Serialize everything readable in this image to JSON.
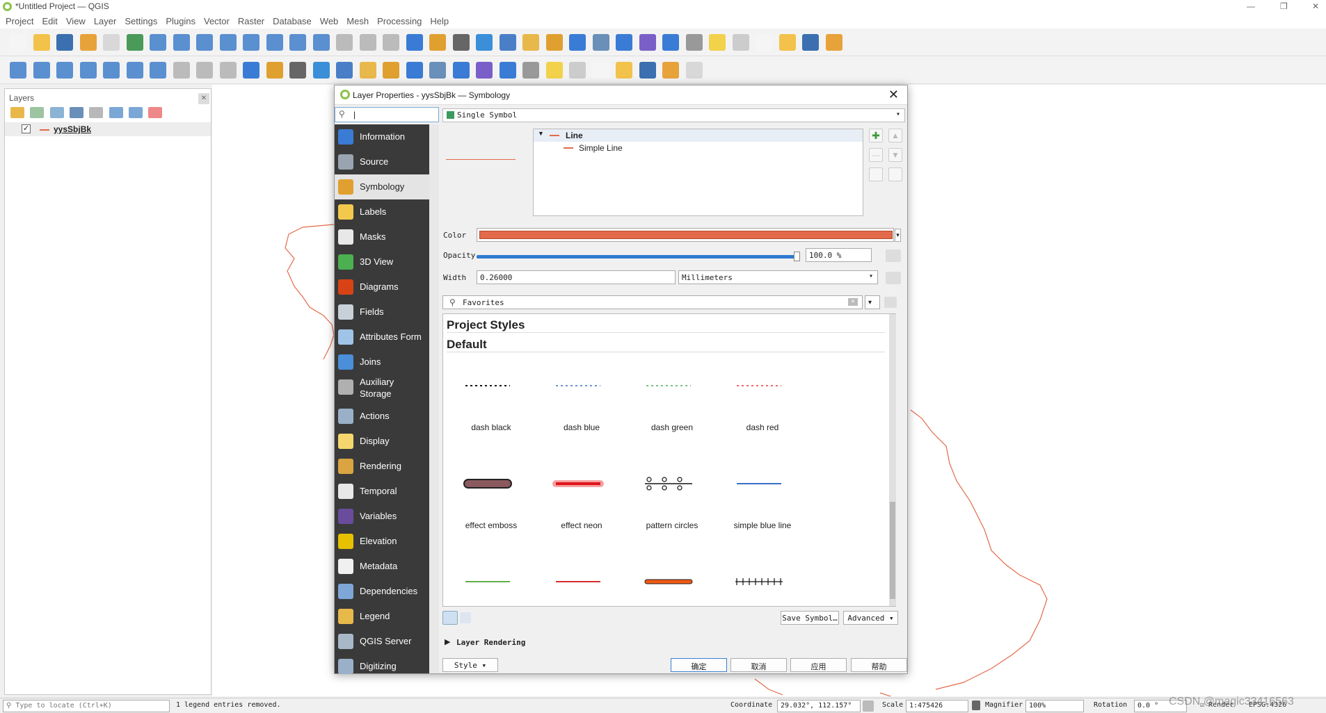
{
  "app": {
    "title": "*Untitled Project — QGIS"
  },
  "menu": [
    "Project",
    "Edit",
    "View",
    "Layer",
    "Settings",
    "Plugins",
    "Vector",
    "Raster",
    "Database",
    "Web",
    "Mesh",
    "Processing",
    "Help"
  ],
  "layers_panel": {
    "title": "Layers",
    "layer_name": "yysSbjBk",
    "checked": "✓"
  },
  "dialog": {
    "title": "Layer Properties - yysSbjBk — Symbology",
    "search_value": "|",
    "renderer": "Single Symbol",
    "nav": [
      {
        "label": "Information",
        "icon": "information-icon",
        "color": "#3a7bd5"
      },
      {
        "label": "Source",
        "icon": "source-icon",
        "color": "#9aa4b0"
      },
      {
        "label": "Symbology",
        "icon": "symbology-icon",
        "color": "#e0a030"
      },
      {
        "label": "Labels",
        "icon": "labels-icon",
        "color": "#f2c94c"
      },
      {
        "label": "Masks",
        "icon": "masks-icon",
        "color": "#e8e8e8"
      },
      {
        "label": "3D View",
        "icon": "3d-view-icon",
        "color": "#4caf50"
      },
      {
        "label": "Diagrams",
        "icon": "diagrams-icon",
        "color": "#d84315"
      },
      {
        "label": "Fields",
        "icon": "fields-icon",
        "color": "#c8d0d8"
      },
      {
        "label": "Attributes Form",
        "icon": "attributes-form-icon",
        "color": "#a0c4e8"
      },
      {
        "label": "Joins",
        "icon": "joins-icon",
        "color": "#4a8fd8"
      },
      {
        "label": "Auxiliary\nStorage",
        "icon": "auxiliary-storage-icon",
        "color": "#b0b0b0"
      },
      {
        "label": "Actions",
        "icon": "actions-icon",
        "color": "#9ab0c8"
      },
      {
        "label": "Display",
        "icon": "display-icon",
        "color": "#f5d76e"
      },
      {
        "label": "Rendering",
        "icon": "rendering-icon",
        "color": "#d9a441"
      },
      {
        "label": "Temporal",
        "icon": "temporal-icon",
        "color": "#e8e8e8"
      },
      {
        "label": "Variables",
        "icon": "variables-icon",
        "color": "#6a4c9c"
      },
      {
        "label": "Elevation",
        "icon": "elevation-icon",
        "color": "#e5c100"
      },
      {
        "label": "Metadata",
        "icon": "metadata-icon",
        "color": "#f0f0f0"
      },
      {
        "label": "Dependencies",
        "icon": "dependencies-icon",
        "color": "#7ea7d8"
      },
      {
        "label": "Legend",
        "icon": "legend-icon",
        "color": "#e7b94a"
      },
      {
        "label": "QGIS Server",
        "icon": "qgis-server-icon",
        "color": "#a8b8c8"
      },
      {
        "label": "Digitizing",
        "icon": "digitizing-icon",
        "color": "#9ab0c8"
      }
    ],
    "tree": {
      "root": "Line",
      "child": "Simple Line"
    },
    "color_label": "Color",
    "color_value": "#e36a4a",
    "opacity_label": "Opacity",
    "opacity_value": "100.0 %",
    "opacity_fraction": 1.0,
    "width_label": "Width",
    "width_value": "0.26000",
    "unit": "Millimeters",
    "favorites": "Favorites",
    "section1": "Project Styles",
    "section2": "Default",
    "symbols": [
      {
        "name": "dash  black",
        "kind": "dash",
        "color": "#111111"
      },
      {
        "name": "dash blue",
        "kind": "dash",
        "color": "#3a6fc4"
      },
      {
        "name": "dash green",
        "kind": "dash",
        "color": "#4caf50"
      },
      {
        "name": "dash red",
        "kind": "dash",
        "color": "#e53935"
      },
      {
        "name": "effect emboss",
        "kind": "emboss",
        "color": "#8a5a5e"
      },
      {
        "name": "effect neon",
        "kind": "neon",
        "color": "#e0151d"
      },
      {
        "name": "pattern circles",
        "kind": "circles",
        "color": "#111111"
      },
      {
        "name": "simple blue line",
        "kind": "line",
        "color": "#3a6fc4"
      },
      {
        "name": "",
        "kind": "line",
        "color": "#5fae4a"
      },
      {
        "name": "",
        "kind": "line",
        "color": "#d32f2f"
      },
      {
        "name": "",
        "kind": "thick",
        "color": "#f05a14"
      },
      {
        "name": "",
        "kind": "ticks",
        "color": "#111111"
      }
    ],
    "save_symbol": "Save Symbol…",
    "advanced": "Advanced",
    "layer_rendering": "Layer Rendering",
    "style": "Style",
    "ok": "确定",
    "cancel": "取消",
    "apply": "应用",
    "help": "帮助"
  },
  "status": {
    "locate_placeholder": "Type to locate (Ctrl+K)",
    "message": "1 legend entries removed.",
    "coordinate_label": "Coordinate",
    "coordinate": "29.032°, 112.157°",
    "scale_label": "Scale",
    "scale": "1:475426",
    "magnifier_label": "Magnifier",
    "magnifier": "100%",
    "rotation_label": "Rotation",
    "rotation": "0.0 °",
    "render": "Render",
    "crs": "EPSG:4326",
    "watermark": "CSDN @magic33416563"
  }
}
